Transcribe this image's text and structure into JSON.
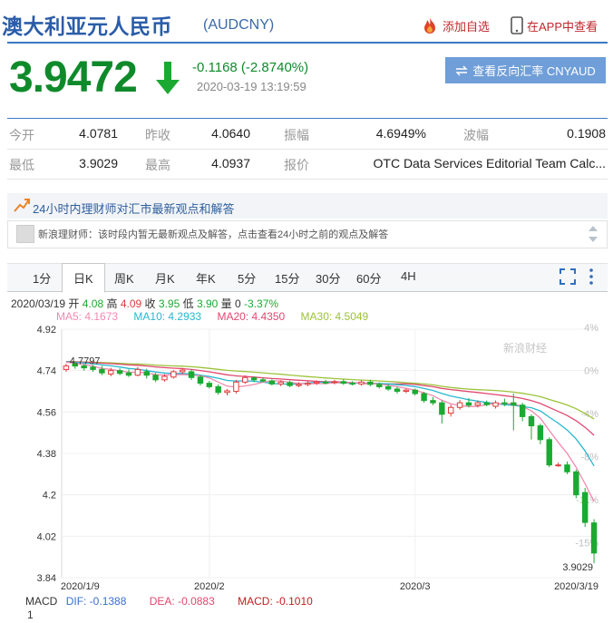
{
  "header": {
    "title": "澳大利亚元人民币",
    "code": "(AUDCNY)",
    "add_fav": "添加自选",
    "view_app": "在APP中查看"
  },
  "price": {
    "last": "3.9472",
    "change": "-0.1168 (-2.8740%)",
    "time": "2020-03-19 13:19:59",
    "reverse_btn": "查看反向汇率 CNYAUD"
  },
  "quote": {
    "row1": [
      {
        "label": "今开",
        "value": "4.0781"
      },
      {
        "label": "昨收",
        "value": "4.0640"
      },
      {
        "label": "振幅",
        "value": "4.6949%"
      },
      {
        "label": "波幅",
        "value": "0.1908"
      }
    ],
    "row2": [
      {
        "label": "最低",
        "value": "3.9029"
      },
      {
        "label": "最高",
        "value": "4.0937"
      },
      {
        "label": "报价",
        "value": "OTC Data Services Editorial Team Calc..."
      }
    ]
  },
  "info": {
    "headline": "24小时内理财师对汇市最新观点和解答",
    "message": "新浪理财师：该时段内暂无最新观点及解答，点击查看24小时之前的观点及解答"
  },
  "tabs": [
    "1分",
    "日K",
    "周K",
    "月K",
    "年K",
    "5分",
    "15分",
    "30分",
    "60分",
    "4H"
  ],
  "active_tab": "日K",
  "ohlc": {
    "date": "2020/03/19",
    "open_label": "开",
    "open": "4.08",
    "high_label": "高",
    "high": "4.09",
    "close_label": "收",
    "close": "3.95",
    "low_label": "低",
    "low": "3.90",
    "vol_label": "量",
    "vol": "0",
    "pct": "-3.37%"
  },
  "ma": {
    "ma5": "MA5: 4.1673",
    "ma10": "MA10: 4.2933",
    "ma20": "MA20: 4.4350",
    "ma30": "MA30: 4.5049"
  },
  "macd": {
    "label": "MACD",
    "dif": "DIF: -0.1388",
    "dea": "DEA: -0.0883",
    "macd": "MACD: -0.1010",
    "axis_top": "1"
  },
  "watermark": "新浪财经",
  "colors": {
    "up": "#e03c3c",
    "down": "#1aaa32",
    "ma5": "#f08ab0",
    "ma10": "#28b8d0",
    "ma20": "#e04870",
    "ma30": "#9cc33a",
    "brand_blue": "#3a79c4"
  },
  "chart_data": {
    "type": "candlestick",
    "y_ticks": [
      "4.92",
      "4.74",
      "4.56",
      "4.38",
      "4.2",
      "4.02",
      "3.84"
    ],
    "y_range": [
      3.84,
      4.92
    ],
    "pct_ticks": [
      "4%",
      "0%",
      "-4%",
      "-8%",
      "-11%",
      "-15%"
    ],
    "x_labels": [
      "2020/1/9",
      "2020/2",
      "2020/3",
      "2020/3/19"
    ],
    "high_label": "4.7797",
    "low_label": "3.9029",
    "candles": [
      {
        "o": 4.745,
        "c": 4.76,
        "h": 4.77,
        "l": 4.735
      },
      {
        "o": 4.77,
        "c": 4.76,
        "h": 4.779,
        "l": 4.748
      },
      {
        "o": 4.76,
        "c": 4.752,
        "h": 4.77,
        "l": 4.74
      },
      {
        "o": 4.755,
        "c": 4.745,
        "h": 4.765,
        "l": 4.735
      },
      {
        "o": 4.745,
        "c": 4.73,
        "h": 4.76,
        "l": 4.72
      },
      {
        "o": 4.725,
        "c": 4.74,
        "h": 4.752,
        "l": 4.715
      },
      {
        "o": 4.74,
        "c": 4.728,
        "h": 4.75,
        "l": 4.72
      },
      {
        "o": 4.73,
        "c": 4.72,
        "h": 4.745,
        "l": 4.712
      },
      {
        "o": 4.72,
        "c": 4.745,
        "h": 4.755,
        "l": 4.715
      },
      {
        "o": 4.735,
        "c": 4.72,
        "h": 4.748,
        "l": 4.705
      },
      {
        "o": 4.72,
        "c": 4.7,
        "h": 4.73,
        "l": 4.69
      },
      {
        "o": 4.7,
        "c": 4.715,
        "h": 4.725,
        "l": 4.692
      },
      {
        "o": 4.712,
        "c": 4.735,
        "h": 4.742,
        "l": 4.705
      },
      {
        "o": 4.735,
        "c": 4.742,
        "h": 4.752,
        "l": 4.725
      },
      {
        "o": 4.735,
        "c": 4.71,
        "h": 4.745,
        "l": 4.7
      },
      {
        "o": 4.712,
        "c": 4.685,
        "h": 4.72,
        "l": 4.675
      },
      {
        "o": 4.685,
        "c": 4.67,
        "h": 4.695,
        "l": 4.662
      },
      {
        "o": 4.67,
        "c": 4.645,
        "h": 4.68,
        "l": 4.635
      },
      {
        "o": 4.645,
        "c": 4.652,
        "h": 4.66,
        "l": 4.632
      },
      {
        "o": 4.65,
        "c": 4.69,
        "h": 4.7,
        "l": 4.64
      },
      {
        "o": 4.69,
        "c": 4.71,
        "h": 4.72,
        "l": 4.682
      },
      {
        "o": 4.708,
        "c": 4.7,
        "h": 4.715,
        "l": 4.69
      },
      {
        "o": 4.7,
        "c": 4.695,
        "h": 4.71,
        "l": 4.688
      },
      {
        "o": 4.695,
        "c": 4.682,
        "h": 4.702,
        "l": 4.675
      },
      {
        "o": 4.682,
        "c": 4.69,
        "h": 4.698,
        "l": 4.672
      },
      {
        "o": 4.688,
        "c": 4.675,
        "h": 4.696,
        "l": 4.668
      },
      {
        "o": 4.675,
        "c": 4.68,
        "h": 4.69,
        "l": 4.668
      },
      {
        "o": 4.68,
        "c": 4.685,
        "h": 4.695,
        "l": 4.672
      },
      {
        "o": 4.685,
        "c": 4.69,
        "h": 4.698,
        "l": 4.678
      },
      {
        "o": 4.69,
        "c": 4.688,
        "h": 4.7,
        "l": 4.68
      },
      {
        "o": 4.688,
        "c": 4.692,
        "h": 4.7,
        "l": 4.68
      },
      {
        "o": 4.692,
        "c": 4.685,
        "h": 4.702,
        "l": 4.678
      },
      {
        "o": 4.685,
        "c": 4.682,
        "h": 4.694,
        "l": 4.675
      },
      {
        "o": 4.682,
        "c": 4.69,
        "h": 4.698,
        "l": 4.675
      },
      {
        "o": 4.69,
        "c": 4.68,
        "h": 4.7,
        "l": 4.672
      },
      {
        "o": 4.68,
        "c": 4.67,
        "h": 4.688,
        "l": 4.662
      },
      {
        "o": 4.67,
        "c": 4.66,
        "h": 4.68,
        "l": 4.652
      },
      {
        "o": 4.66,
        "c": 4.65,
        "h": 4.67,
        "l": 4.64
      },
      {
        "o": 4.65,
        "c": 4.655,
        "h": 4.662,
        "l": 4.642
      },
      {
        "o": 4.655,
        "c": 4.64,
        "h": 4.662,
        "l": 4.632
      },
      {
        "o": 4.64,
        "c": 4.61,
        "h": 4.648,
        "l": 4.6
      },
      {
        "o": 4.61,
        "c": 4.6,
        "h": 4.625,
        "l": 4.59
      },
      {
        "o": 4.6,
        "c": 4.55,
        "h": 4.61,
        "l": 4.51
      },
      {
        "o": 4.555,
        "c": 4.58,
        "h": 4.592,
        "l": 4.54
      },
      {
        "o": 4.58,
        "c": 4.6,
        "h": 4.612,
        "l": 4.57
      },
      {
        "o": 4.6,
        "c": 4.59,
        "h": 4.62,
        "l": 4.58
      },
      {
        "o": 4.59,
        "c": 4.6,
        "h": 4.61,
        "l": 4.58
      },
      {
        "o": 4.6,
        "c": 4.592,
        "h": 4.61,
        "l": 4.585
      },
      {
        "o": 4.585,
        "c": 4.6,
        "h": 4.61,
        "l": 4.575
      },
      {
        "o": 4.6,
        "c": 4.596,
        "h": 4.618,
        "l": 4.585
      },
      {
        "o": 4.6,
        "c": 4.59,
        "h": 4.64,
        "l": 4.48
      },
      {
        "o": 4.59,
        "c": 4.54,
        "h": 4.6,
        "l": 4.52
      },
      {
        "o": 4.54,
        "c": 4.5,
        "h": 4.55,
        "l": 4.44
      },
      {
        "o": 4.5,
        "c": 4.44,
        "h": 4.51,
        "l": 4.42
      },
      {
        "o": 4.44,
        "c": 4.33,
        "h": 4.45,
        "l": 4.32
      },
      {
        "o": 4.33,
        "c": 4.33,
        "h": 4.34,
        "l": 4.322
      },
      {
        "o": 4.33,
        "c": 4.3,
        "h": 4.345,
        "l": 4.29
      },
      {
        "o": 4.3,
        "c": 4.2,
        "h": 4.31,
        "l": 4.185
      },
      {
        "o": 4.21,
        "c": 4.08,
        "h": 4.23,
        "l": 4.06
      },
      {
        "o": 4.078,
        "c": 3.947,
        "h": 4.094,
        "l": 3.903
      }
    ]
  }
}
